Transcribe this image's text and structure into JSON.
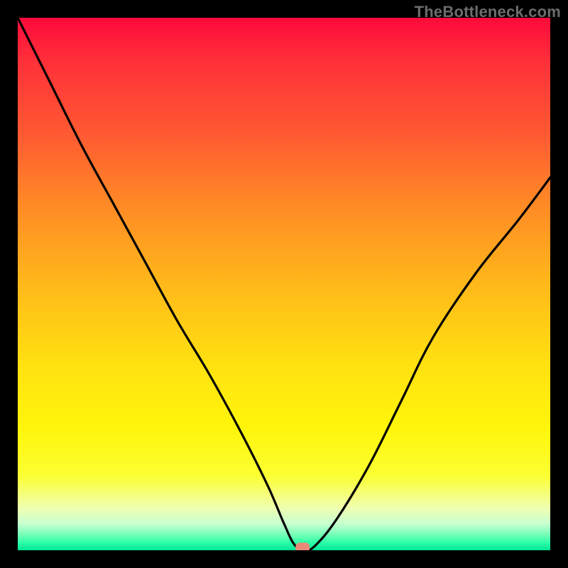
{
  "watermark": "TheBottleneck.com",
  "chart_data": {
    "type": "line",
    "title": "",
    "xlabel": "",
    "ylabel": "",
    "xlim": [
      0,
      100
    ],
    "ylim": [
      0,
      100
    ],
    "grid": false,
    "legend": false,
    "description": "Bottleneck percentage curve over component balance; background gradient red (high bottleneck) to green (no bottleneck). Minimum near x≈53.",
    "series": [
      {
        "name": "bottleneck-curve",
        "x": [
          0,
          6,
          12,
          18,
          24,
          30,
          36,
          42,
          47,
          50,
          52,
          54,
          56,
          60,
          66,
          72,
          78,
          86,
          94,
          100
        ],
        "values": [
          100,
          88,
          76,
          65,
          54,
          43,
          33,
          22,
          12,
          5,
          1,
          0,
          1,
          6,
          16,
          28,
          40,
          52,
          62,
          70
        ]
      }
    ],
    "marker": {
      "x": 53.5,
      "y": 0.5,
      "shape": "rounded-rect",
      "color": "#e88a77"
    }
  }
}
